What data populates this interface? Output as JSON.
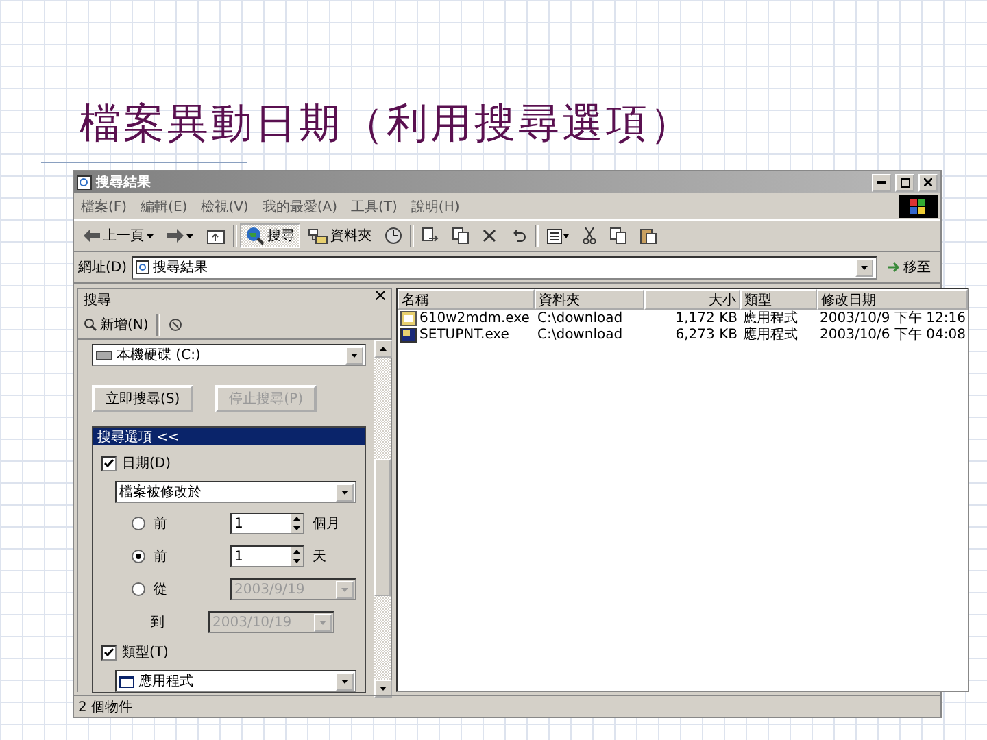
{
  "slide": {
    "title": "檔案異動日期（利用搜尋選項）"
  },
  "window": {
    "title": "搜尋結果",
    "menu": [
      "檔案(F)",
      "編輯(E)",
      "檢視(V)",
      "我的最愛(A)",
      "工具(T)",
      "說明(H)"
    ],
    "toolbar": [
      {
        "kind": "back",
        "label": "上一頁",
        "selected": false
      },
      {
        "kind": "forward",
        "selected": false
      },
      {
        "kind": "up",
        "selected": false
      },
      {
        "kind": "search",
        "label": "搜尋",
        "selected": true
      },
      {
        "kind": "folders",
        "label": "資料夾",
        "selected": false
      },
      {
        "kind": "history",
        "selected": false
      },
      {
        "kind": "move",
        "selected": false
      },
      {
        "kind": "copy",
        "selected": false
      },
      {
        "kind": "delete",
        "selected": false
      },
      {
        "kind": "undo",
        "selected": false
      },
      {
        "kind": "views",
        "selected": false
      },
      {
        "kind": "cut",
        "selected": false
      },
      {
        "kind": "copy",
        "selected": false
      },
      {
        "kind": "paste",
        "selected": false
      }
    ],
    "address": {
      "label": "網址(D)",
      "value": "搜尋結果",
      "go": "移至"
    },
    "search_pane": {
      "title": "搜尋",
      "new": "新增(N)",
      "look_in": "本機硬碟 (C:)",
      "search_button": {
        "label": "立即搜尋(S)",
        "disabled": false
      },
      "stop_button": {
        "label": "停止搜尋(P)",
        "disabled": true
      },
      "options_header": "搜尋選項 <<",
      "date_option": {
        "label": "日期(D)",
        "checked": true
      },
      "date_type": "檔案被修改於",
      "ranges": [
        {
          "prefix": "前",
          "value": "1",
          "unit": "個月",
          "selected": false
        },
        {
          "prefix": "前",
          "value": "1",
          "unit": "天",
          "selected": true
        }
      ],
      "between": {
        "prefix": "從",
        "from": "2003/9/19",
        "to_label": "到",
        "to": "2003/10/19",
        "selected": false,
        "disabled": true
      },
      "type_option": {
        "label": "類型(T)",
        "checked": true
      },
      "type_value": "應用程式"
    },
    "columns": [
      "名稱",
      "資料夾",
      "大小",
      "類型",
      "修改日期"
    ],
    "rows": [
      {
        "kind": "setup",
        "cells": [
          "610w2mdm.exe",
          "C:\\download",
          "1,172 KB",
          "應用程式",
          "2003/10/9 下午 12:16"
        ]
      },
      {
        "kind": "installer",
        "cells": [
          "SETUPNT.exe",
          "C:\\download",
          "6,273 KB",
          "應用程式",
          "2003/10/6 下午 04:08"
        ]
      }
    ],
    "status": "2 個物件"
  }
}
